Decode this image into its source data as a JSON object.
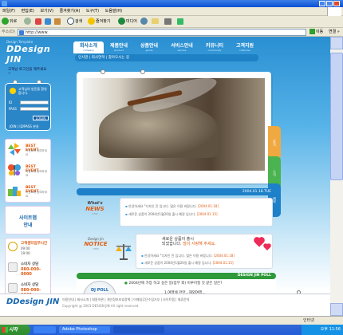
{
  "browser": {
    "menus": [
      "파일(F)",
      "편집(E)",
      "보기(V)",
      "즐겨찾기(A)",
      "도구(T)",
      "도움말(H)"
    ],
    "toolbar": {
      "back": "뒤로",
      "search": "검색",
      "favorites": "즐겨찾기",
      "media": "미디어"
    },
    "address_label": "주소(D)",
    "address_value": "http://www.",
    "go_label": "이동",
    "links_label": "연결 »",
    "status_text": "",
    "zone_text": "인터넷"
  },
  "taskbar": {
    "start_label": "시작",
    "tasks": [
      "",
      "Adobe Photoshop",
      ""
    ],
    "clock": "오후 11:56"
  },
  "site": {
    "logo_small": "Design Template",
    "logo_main": "DDesign JIN",
    "nav": [
      {
        "label": "회사소개",
        "sub": "company"
      },
      {
        "label": "제품안내",
        "sub": "product"
      },
      {
        "label": "상품안내",
        "sub": "goods"
      },
      {
        "label": "서비스안내",
        "sub": "service"
      },
      {
        "label": "커뮤니티",
        "sub": "community"
      },
      {
        "label": "고객지원",
        "sub": "customer"
      }
    ],
    "subnav": "인사말 | 회사연혁 | 찾아오시는 길",
    "login": {
      "greeting": "고객님 로그인을 해주세요~",
      "note": "고객님의 방문을 환영합니다.",
      "id_label": "ID",
      "pass_label": "PASS",
      "button": "LOGIN",
      "links": "JOIN | ID/PASS 분실"
    },
    "events": [
      {
        "title": "BEST EVENT",
        "text": "이벤트에 참여하세요"
      },
      {
        "title": "BEST EVENT",
        "text": "이벤트에 참여하세요"
      },
      {
        "title": "BEST EVENT",
        "text": "이벤트에 참여하세요"
      }
    ],
    "sitemap": {
      "line1": "사이트맵",
      "line2": "안내"
    },
    "cs": {
      "hours_title": "고객센터업무시간",
      "hours_from": "09:00",
      "hours_to": "19:00",
      "consult1_title": "소비자 상담",
      "consult1_phone": "080-000-0000",
      "consult2_title": "소비자 상담",
      "consult2_phone": "080-000-0000"
    },
    "date_label": "2004.01.18.TUE",
    "news": {
      "badge_top": "What's",
      "badge_main": "NEWS",
      "badge_sub": "new",
      "items": [
        {
          "text": "안녕하세요 \"디자인 진 입니다. 많은 이용 바랍니다.",
          "date": "[2004.01.18]"
        },
        {
          "text": "새로운 상품이 2004년1월20일 출시 예정 입니다.",
          "date": "[2004.01.15]"
        }
      ]
    },
    "notice": {
      "badge_top": "Design Jin",
      "badge_main": "NOTICE",
      "badge_sub": "new",
      "headline1": "새로운 상품이 출시",
      "headline2": "되었습니다.",
      "headline3": "많이 사랑해 주세요.",
      "items": [
        {
          "text": "안녕하세요 \"디자인 진 입니다. 많은 이용 바랍니다.",
          "date": "[2004.01.18]"
        },
        {
          "text": "새로운 상품이 2004년1월20일 출시 예정 입니다.",
          "date": "[2004.01.15]"
        }
      ]
    },
    "poll_bar": "DESIGN JIN POLL",
    "poll": {
      "cup_label": "DJ POLL",
      "question": "2004년에 가장 하고 싶은 일(업무 외) 이루어질 것 같은 일은?",
      "options": [
        "1.여행에 관한...해외여행...",
        "2.건강을 위해 이루기...체육합니다.",
        "3.이직 해보기 같다...체계합니다."
      ],
      "vote_btn": "결과",
      "result_btn": "투표"
    },
    "footer": {
      "logo": "DDesign JIN",
      "links": "이용안내 | 회사소개 | 회원약관 | 개인정보보호정책 | 이메일무단수집거부 | 사이트맵 | 제휴문의",
      "copyright": "Copyright @ 2003 DESIGN JIN All right reserved."
    },
    "side_tabs": [
      "문의",
      "소식",
      "예약"
    ]
  }
}
